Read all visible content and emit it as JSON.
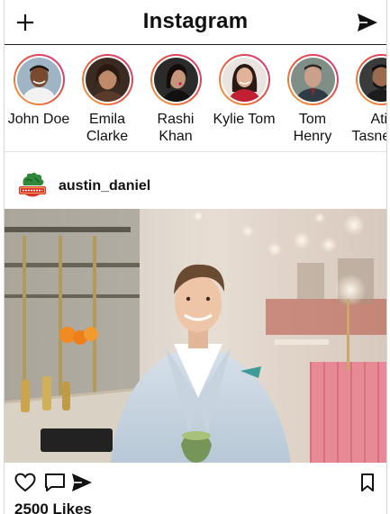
{
  "header": {
    "title": "Instagram",
    "left_icon": "plus-icon",
    "right_icon": "send-icon"
  },
  "stories": [
    {
      "name": "John Doe"
    },
    {
      "name": "Emila Clarke"
    },
    {
      "name": "Rashi Khan"
    },
    {
      "name": "Kylie Tom"
    },
    {
      "name": "Tom Henry"
    },
    {
      "name": "Atif Tasneem"
    }
  ],
  "post": {
    "username": "austin_daniel",
    "likes_text": "2500 Likes",
    "action_icons": [
      "heart-icon",
      "comment-icon",
      "share-icon",
      "bookmark-icon"
    ]
  },
  "colors": {
    "story_ring_start": "#f5a742",
    "story_ring_end": "#d4307b",
    "text": "#111111"
  }
}
